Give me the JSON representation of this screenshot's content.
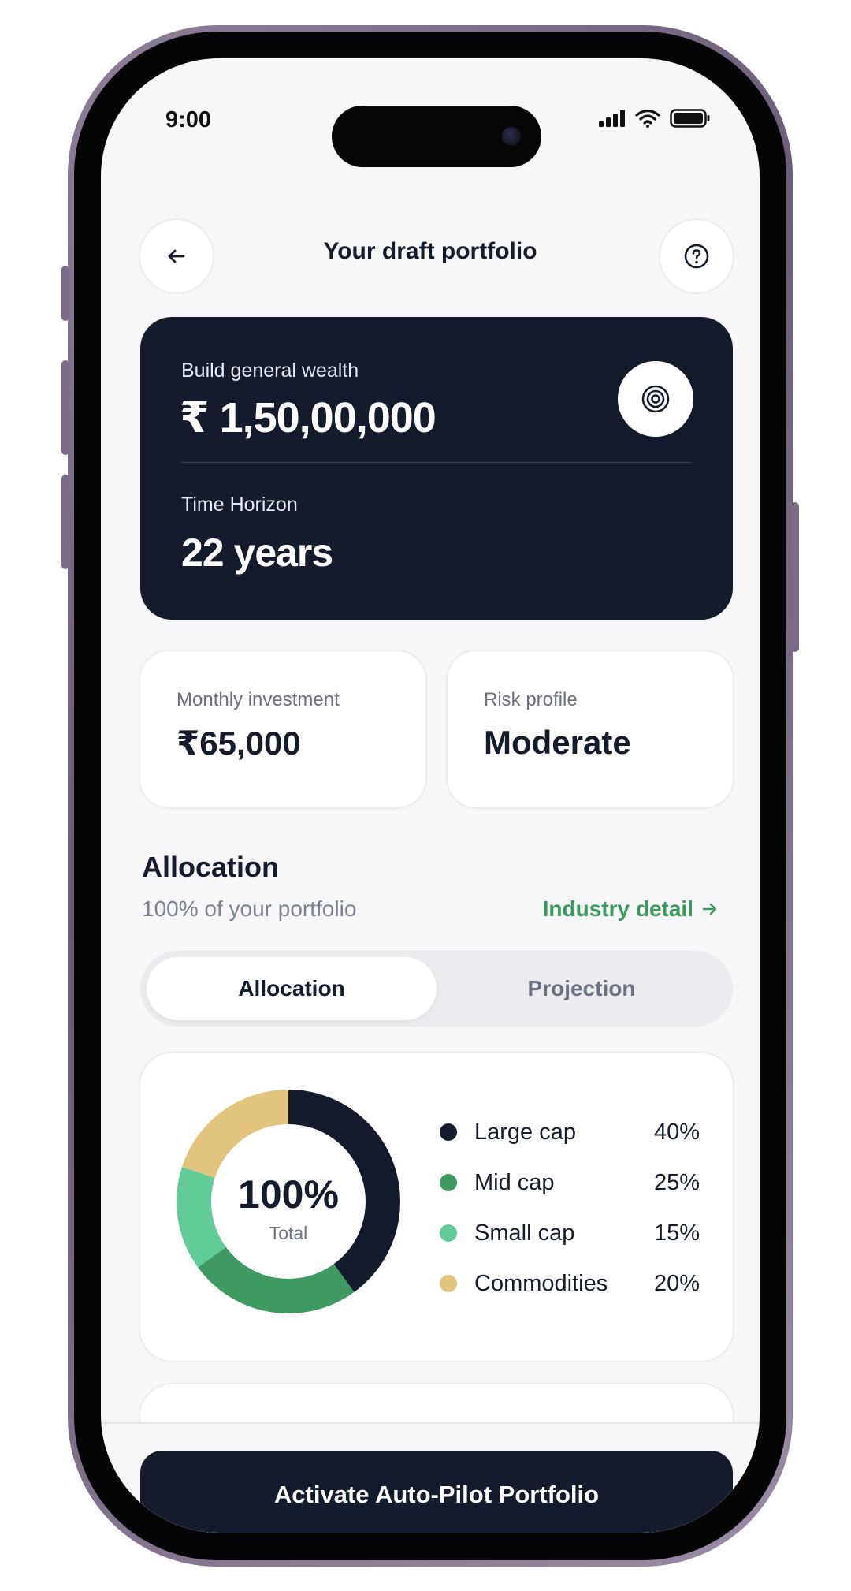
{
  "status_bar": {
    "time": "9:00"
  },
  "header": {
    "title": "Your draft portfolio",
    "back_icon": "arrow-left-icon",
    "help_icon": "question-circle-icon"
  },
  "goal_card": {
    "goal_label": "Build general wealth",
    "goal_amount": "₹ 1,50,00,000",
    "horizon_label": "Time Horizon",
    "horizon_value": "22 years",
    "target_icon": "target-icon"
  },
  "monthly_investment": {
    "label": "Monthly investment",
    "value": "₹65,000"
  },
  "risk_profile": {
    "label": "Risk profile",
    "value": "Moderate"
  },
  "allocation": {
    "title": "Allocation",
    "subtitle": "100% of your portfolio",
    "link_label": "Industry detail",
    "tabs": [
      {
        "label": "Allocation",
        "active": true
      },
      {
        "label": "Projection",
        "active": false
      }
    ],
    "center_value": "100%",
    "center_label": "Total"
  },
  "chart_data": {
    "type": "pie",
    "categories": [
      "Large cap",
      "Mid cap",
      "Small cap",
      "Commodities"
    ],
    "values": [
      40,
      25,
      15,
      20
    ],
    "labels": [
      "40%",
      "25%",
      "15%",
      "20%"
    ],
    "colors": [
      "#141b2d",
      "#3f9a62",
      "#62cc98",
      "#e3c47e"
    ],
    "donut": true
  },
  "cta": {
    "label": "Activate Auto-Pilot Portfolio"
  }
}
